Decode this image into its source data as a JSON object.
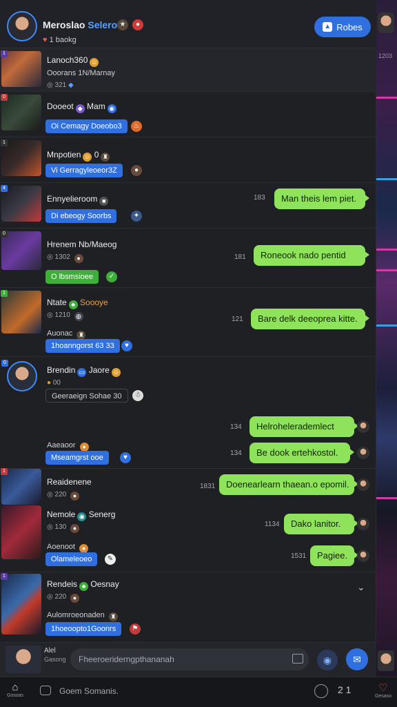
{
  "header": {
    "title": "Meroslao",
    "title_highlight": "Selerot",
    "subtitle": "1 baokg",
    "follow_label": "Robes",
    "side_label": "1203"
  },
  "rows": [
    {
      "name": "Lanoch360",
      "meta": "Ooorans 1N/Marnay",
      "meta2": "321"
    },
    {
      "name": "Dooeot",
      "name2": "Mam",
      "tag": "Oi Cemagy Doeobo3"
    },
    {
      "name": "Mnpotien",
      "name2": "0",
      "tag": "Vi Gerragyleoeor3Z"
    },
    {
      "name": "Ennyelieroom",
      "tag": "Di ebeogy Soorbs",
      "bubble": "Man theis lem piet.",
      "time": "183"
    },
    {
      "name": "Hrenem Nb/Maeog",
      "meta": "1302",
      "tag": "O lbsmsioee",
      "bubble": "Roneook nado pentid",
      "time": "181"
    },
    {
      "name": "Ntate",
      "name2": "Soooye",
      "meta": "1210",
      "sub": "Auonac",
      "tag": "1hoanngorst 63 33",
      "bubble": "Bare delk deeoprea kitte.",
      "time": "121"
    },
    {
      "name": "Brendin",
      "name2": "Jaore",
      "meta": "00",
      "tag": "Geeraeign Sohae 30",
      "sub": "Aaeaoor",
      "tag2": "Mseamgrst ooe",
      "bubble1": "Helrohelerademlect",
      "time1": "134",
      "bubble2": "Be dook ertehkostol.",
      "time2": "134"
    },
    {
      "name": "Reaidenene",
      "meta": "220",
      "bubble": "Doenearlearn thaean.o epomil.",
      "time": "1831"
    },
    {
      "name": "Nemole",
      "name2": "Senerg",
      "meta": "130",
      "sub": "Aoenoot",
      "tag": "Olameleoeo",
      "bubble1": "Dako lanitor.",
      "time1": "1134",
      "bubble2": "Pagiee.",
      "time2": "1531"
    },
    {
      "name": "Rendeis",
      "name2": "Oesnay",
      "meta": "220",
      "sub": "Aulomroeonaden",
      "tag": "1hoeoopto1Goonrs"
    }
  ],
  "composer": {
    "me_label": "Alel",
    "me_sub": "Gasong",
    "placeholder": "Fheeroeriderngpthananah"
  },
  "bottom_nav": {
    "home_label": "Gosoas",
    "comment_placeholder": "Goem Somanis.",
    "count": "2 1",
    "right_label": "Gesaso"
  },
  "colors": {
    "accent_blue": "#2f6fe0",
    "bubble_green": "#8ee35a",
    "tag_green": "#3fae3a",
    "background": "#1f2024"
  }
}
